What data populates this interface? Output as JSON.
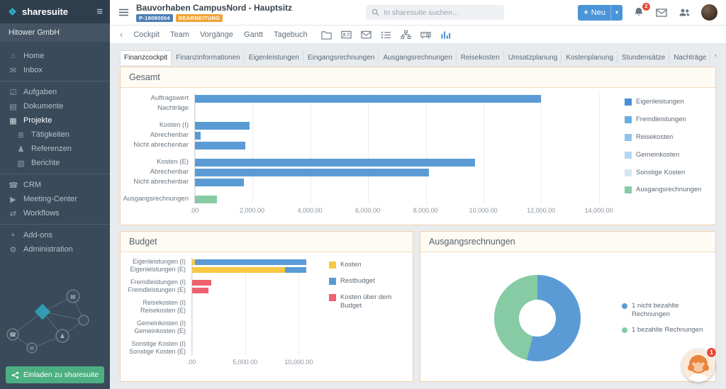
{
  "colors": {
    "accent_blue": "#4a94d8",
    "badge_blue": "#4d7fb5",
    "status_orange": "#f0a437",
    "invite_green": "#4caf82",
    "notification_red": "#e74c3c",
    "sidebar_bg": "#394a5a",
    "card_border": "#f0cfa8"
  },
  "sidebar": {
    "brand": "sharesuite",
    "org": "Hitower GmbH",
    "invite_button": "Einladen zu sharesuite",
    "groups": [
      [
        {
          "label": "Home",
          "icon": "home-icon"
        },
        {
          "label": "Inbox",
          "icon": "inbox-icon"
        }
      ],
      [
        {
          "label": "Aufgaben",
          "icon": "tasks-icon"
        },
        {
          "label": "Dokumente",
          "icon": "documents-icon"
        },
        {
          "label": "Projekte",
          "icon": "projects-icon",
          "active": true
        },
        {
          "label": "Tätigkeiten",
          "icon": "activities-icon",
          "indent": true
        },
        {
          "label": "Referenzen",
          "icon": "references-icon",
          "indent": true
        },
        {
          "label": "Berichte",
          "icon": "reports-icon",
          "indent": true
        }
      ],
      [
        {
          "label": "CRM",
          "icon": "crm-icon"
        },
        {
          "label": "Meeting-Center",
          "icon": "meeting-icon"
        },
        {
          "label": "Workflows",
          "icon": "workflows-icon"
        }
      ],
      [
        {
          "label": "Add-ons",
          "icon": "addons-icon"
        },
        {
          "label": "Administration",
          "icon": "admin-icon"
        }
      ]
    ]
  },
  "topbar": {
    "title": "Bauvorhaben CampusNord - Hauptsitz",
    "project_badge": "P-18080004",
    "status_badge": "BEARBEITUNG",
    "search_placeholder": "In sharesuite suchen...",
    "new_button": "Neu",
    "notification_count": "2"
  },
  "project_nav": {
    "links": [
      "Cockpit",
      "Team",
      "Vorgänge",
      "Gantt",
      "Tagebuch"
    ],
    "icons": [
      "folder-icon",
      "contact-card-icon",
      "mail-icon",
      "task-list-icon",
      "org-chart-icon",
      "projector-icon",
      "finance-chart-icon"
    ],
    "active_icon": "finance-chart-icon"
  },
  "finance_tabs": {
    "active": "Finanzcockpit",
    "items": [
      "Finanzcockpit",
      "Finanzinformationen",
      "Eigenleistungen",
      "Eingangsrechnungen",
      "Ausgangsrechnungen",
      "Reisekosten",
      "Umsatzplanung",
      "Kostenplanung",
      "Stundensätze",
      "Nachträge",
      "Vorgänge"
    ]
  },
  "cards": {
    "gesamt_title": "Gesamt",
    "budget_title": "Budget",
    "invoices_title": "Ausgangsrechnungen"
  },
  "charts": {
    "gesamt": {
      "type": "bar",
      "title": "Gesamt",
      "axis_max": 14400,
      "ticks": [
        {
          "label": ".00",
          "value": 0
        },
        {
          "label": "2,000.00",
          "value": 2000
        },
        {
          "label": "4,000.00",
          "value": 4000
        },
        {
          "label": "6,000.00",
          "value": 6000
        },
        {
          "label": "8,000.00",
          "value": 8000
        },
        {
          "label": "10,000.00",
          "value": 10000
        },
        {
          "label": "12,000.00",
          "value": 12000
        },
        {
          "label": "14,000.00",
          "value": 14000
        }
      ],
      "rows": [
        {
          "label": "Auftragswert",
          "segments": [
            {
              "color": "#5b9bd5",
              "value": 12000
            }
          ]
        },
        {
          "label": "Nachträge",
          "segments": []
        },
        {
          "gap": true
        },
        {
          "label": "Kosten (I)",
          "segments": [
            {
              "color": "#5b9bd5",
              "value": 1900
            }
          ]
        },
        {
          "label": "Abrechenbar",
          "segments": [
            {
              "color": "#5b9bd5",
              "value": 200
            }
          ]
        },
        {
          "label": "Nicht abrechenbar",
          "segments": [
            {
              "color": "#5b9bd5",
              "value": 1750
            }
          ]
        },
        {
          "gap": true
        },
        {
          "label": "Kosten (E)",
          "segments": [
            {
              "color": "#5b9bd5",
              "value": 9700
            }
          ]
        },
        {
          "label": "Abrechenbar",
          "segments": [
            {
              "color": "#5b9bd5",
              "value": 8100
            }
          ]
        },
        {
          "label": "Nicht abrechenbar",
          "segments": [
            {
              "color": "#5b9bd5",
              "value": 1700
            }
          ]
        },
        {
          "gap": true
        },
        {
          "label": "Ausgangsrechnungen",
          "segments": [
            {
              "color": "#87cba4",
              "value": 750
            }
          ]
        }
      ],
      "legend": [
        {
          "label": "Eigenleistungen",
          "color": "#4a90d5"
        },
        {
          "label": "Fremdleistungen",
          "color": "#6aaede"
        },
        {
          "label": "Reisekosten",
          "color": "#8ec4e8"
        },
        {
          "label": "Gemeinkosten",
          "color": "#b3d7f0"
        },
        {
          "label": "Sonstige Kosten",
          "color": "#d2e6f5"
        },
        {
          "label": "Ausgangsrechnungen",
          "color": "#87cba4"
        }
      ]
    },
    "budget": {
      "type": "bar",
      "title": "Budget",
      "axis_max": 11500,
      "ticks": [
        {
          "label": ".00",
          "value": 0
        },
        {
          "label": "5,000.00",
          "value": 5000
        },
        {
          "label": "10,000.00",
          "value": 10000
        }
      ],
      "rows": [
        {
          "label": "Eigenleistungen (I)",
          "segments": [
            {
              "color": "#f7c844",
              "value": 250
            },
            {
              "color": "#5b9bd5",
              "value": 10450
            }
          ]
        },
        {
          "label": "Eigenleistungen (E)",
          "segments": [
            {
              "color": "#f7c844",
              "value": 8700
            },
            {
              "color": "#5b9bd5",
              "value": 2000
            }
          ]
        },
        {
          "gap": true
        },
        {
          "label": "Fremdleistungen (I)",
          "segments": [
            {
              "color": "#f0616e",
              "value": 1800
            }
          ]
        },
        {
          "label": "Fremdleistungen (E)",
          "segments": [
            {
              "color": "#f0616e",
              "value": 1500
            }
          ]
        },
        {
          "gap": true
        },
        {
          "label": "Reisekosten (I)",
          "segments": []
        },
        {
          "label": "Reisekosten (E)",
          "segments": []
        },
        {
          "gap": true
        },
        {
          "label": "Gemeinkosten (I)",
          "segments": []
        },
        {
          "label": "Gemeinkosten (E)",
          "segments": []
        },
        {
          "gap": true
        },
        {
          "label": "Sonstige Kosten (I)",
          "segments": []
        },
        {
          "label": "Sonstige Kosten (E)",
          "segments": []
        }
      ],
      "legend": [
        {
          "label": "Kosten",
          "color": "#f7c844"
        },
        {
          "label": "Restbudget",
          "color": "#5b9bd5"
        },
        {
          "label": "Kosten über dem Budget",
          "color": "#f0616e"
        }
      ]
    },
    "invoices": {
      "type": "donut",
      "title": "Ausgangsrechnungen",
      "slices": [
        {
          "label": "1 nicht bezahlte Rechnungen",
          "color": "#5b9bd5",
          "value": 54
        },
        {
          "label": "1 bezahlte Rechnungen",
          "color": "#87cba4",
          "value": 46
        }
      ],
      "legend": [
        {
          "label": "1 nicht bezahlte Rechnungen",
          "color": "#5b9bd5"
        },
        {
          "label": "1 bezahlte Rechnungen",
          "color": "#87cba4"
        }
      ]
    }
  },
  "chat": {
    "badge": "1"
  }
}
